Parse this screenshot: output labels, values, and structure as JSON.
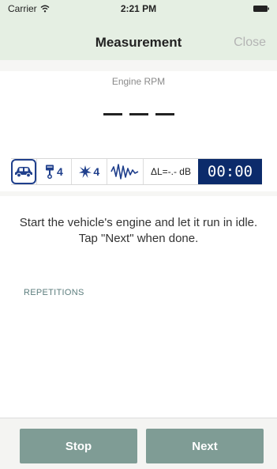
{
  "status_bar": {
    "carrier": "Carrier",
    "time": "2:21 PM"
  },
  "nav": {
    "title": "Measurement",
    "close_label": "Close"
  },
  "engine": {
    "label": "Engine RPM"
  },
  "toolbar": {
    "cylinders": "4",
    "ignitions": "4",
    "level": "ΔL=-.- dB",
    "timer": "00:00"
  },
  "instruction": "Start the vehicle's engine and let it run in idle. Tap \"Next\" when done.",
  "repetitions": {
    "header": "REPETITIONS"
  },
  "actions": {
    "stop_label": "Stop",
    "next_label": "Next"
  },
  "colors": {
    "header_bg": "#e5efe3",
    "accent": "#1f3f8c",
    "timer_bg": "#0c2b6b",
    "button_bg": "#7f9c95"
  }
}
